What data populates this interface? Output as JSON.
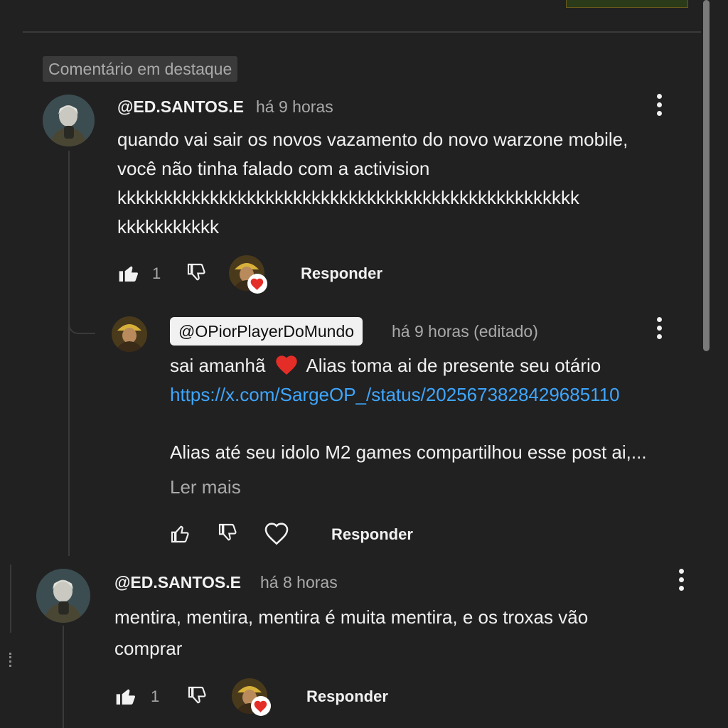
{
  "pinned_label": "Comentário em destaque",
  "comments": [
    {
      "author": "@ED.SANTOS.E",
      "time": "há 9 horas",
      "text": "quando vai sair os novos vazamento do novo warzone mobile,\nvocê não tinha falado com a activision\nkkkkkkkkkkkkkkkkkkkkkkkkkkkkkkkkkkkkkkkkkkkkkkkkkk\nkkkkkkkkkkk",
      "likes": "1",
      "reply_label": "Responder"
    },
    {
      "author": "@ED.SANTOS.E",
      "time": "há 8 horas",
      "text": "mentira, mentira, mentira é muita mentira, e os troxas vão\ncomprar",
      "likes": "1",
      "reply_label": "Responder"
    }
  ],
  "reply": {
    "author": "@OPiorPlayerDoMundo",
    "time": "há 9 horas (editado)",
    "line1_a": "sai amanhã",
    "line1_b": "Alias toma ai de presente seu otário",
    "link": "https://x.com/SargeOP_/status/2025673828429685110",
    "line3": "Alias até seu idolo M2 games compartilhou esse post ai,...",
    "read_more": "Ler mais",
    "reply_label": "Responder"
  },
  "icons": {
    "like": "thumbs-up-icon",
    "dislike": "thumbs-down-icon",
    "heart": "heart-icon",
    "more": "more-vert-icon"
  },
  "colors": {
    "background": "#212121",
    "link": "#3ea6ff",
    "heart": "#e52d27",
    "secondary_text": "#aaaaaa"
  }
}
